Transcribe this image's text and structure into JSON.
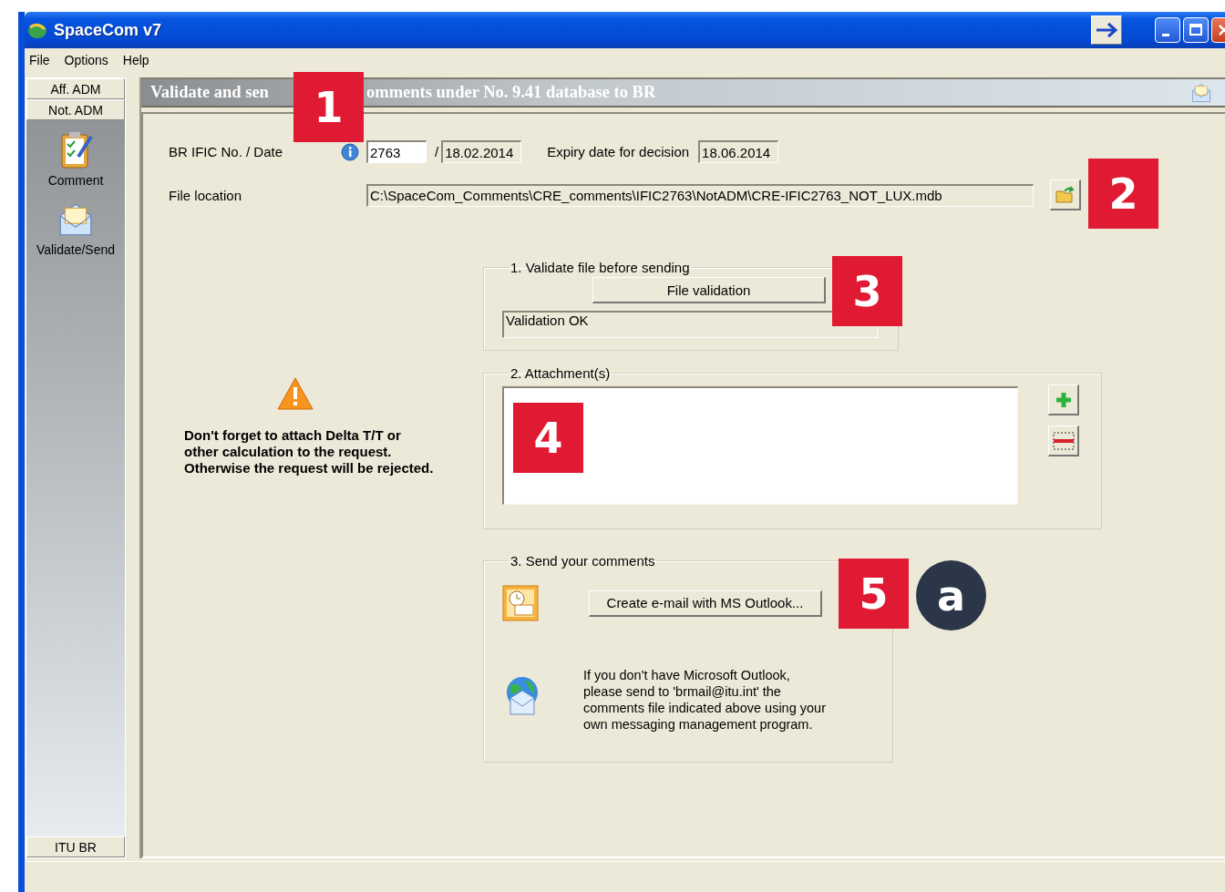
{
  "window": {
    "title": "SpaceCom v7"
  },
  "menu": [
    "File",
    "Options",
    "Help"
  ],
  "sidebar": {
    "tabs": [
      "Aff. ADM",
      "Not. ADM"
    ],
    "items": [
      "Comment",
      "Validate/Send"
    ],
    "footer_tab": "ITU BR"
  },
  "header": {
    "title_parts": [
      "Validate and sen",
      "omments under No. 9.41 database to BR"
    ]
  },
  "form": {
    "ific_label": "BR IFIC No. / Date",
    "ific_no": "2763",
    "separator": "/",
    "ific_date": "18.02.2014",
    "expiry_label": "Expiry date for decision",
    "expiry_date": "18.06.2014",
    "file_label": "File location",
    "file_path": "C:\\SpaceCom_Comments\\CRE_comments\\IFIC2763\\NotADM\\CRE-IFIC2763_NOT_LUX.mdb"
  },
  "warning": {
    "lines": [
      "Don't forget to attach Delta T/T or",
      "other calculation to the request.",
      "Otherwise the request will be rejected."
    ]
  },
  "validate_group": {
    "legend": "1. Validate file before sending",
    "button": "File validation",
    "result": "Validation OK"
  },
  "attachments_group": {
    "legend": "2. Attachment(s)"
  },
  "send_group": {
    "legend": "3. Send your comments",
    "button": "Create e-mail with MS Outlook...",
    "note_lines": [
      "If you don't have Microsoft Outlook,",
      "please send to 'brmail@itu.int' the",
      "comments file indicated above using your",
      "own messaging management program."
    ]
  },
  "callouts": [
    {
      "label": "1",
      "kind": "square"
    },
    {
      "label": "2",
      "kind": "square"
    },
    {
      "label": "3",
      "kind": "square"
    },
    {
      "label": "4",
      "kind": "square"
    },
    {
      "label": "5",
      "kind": "square"
    },
    {
      "label": "a",
      "kind": "circle"
    }
  ]
}
